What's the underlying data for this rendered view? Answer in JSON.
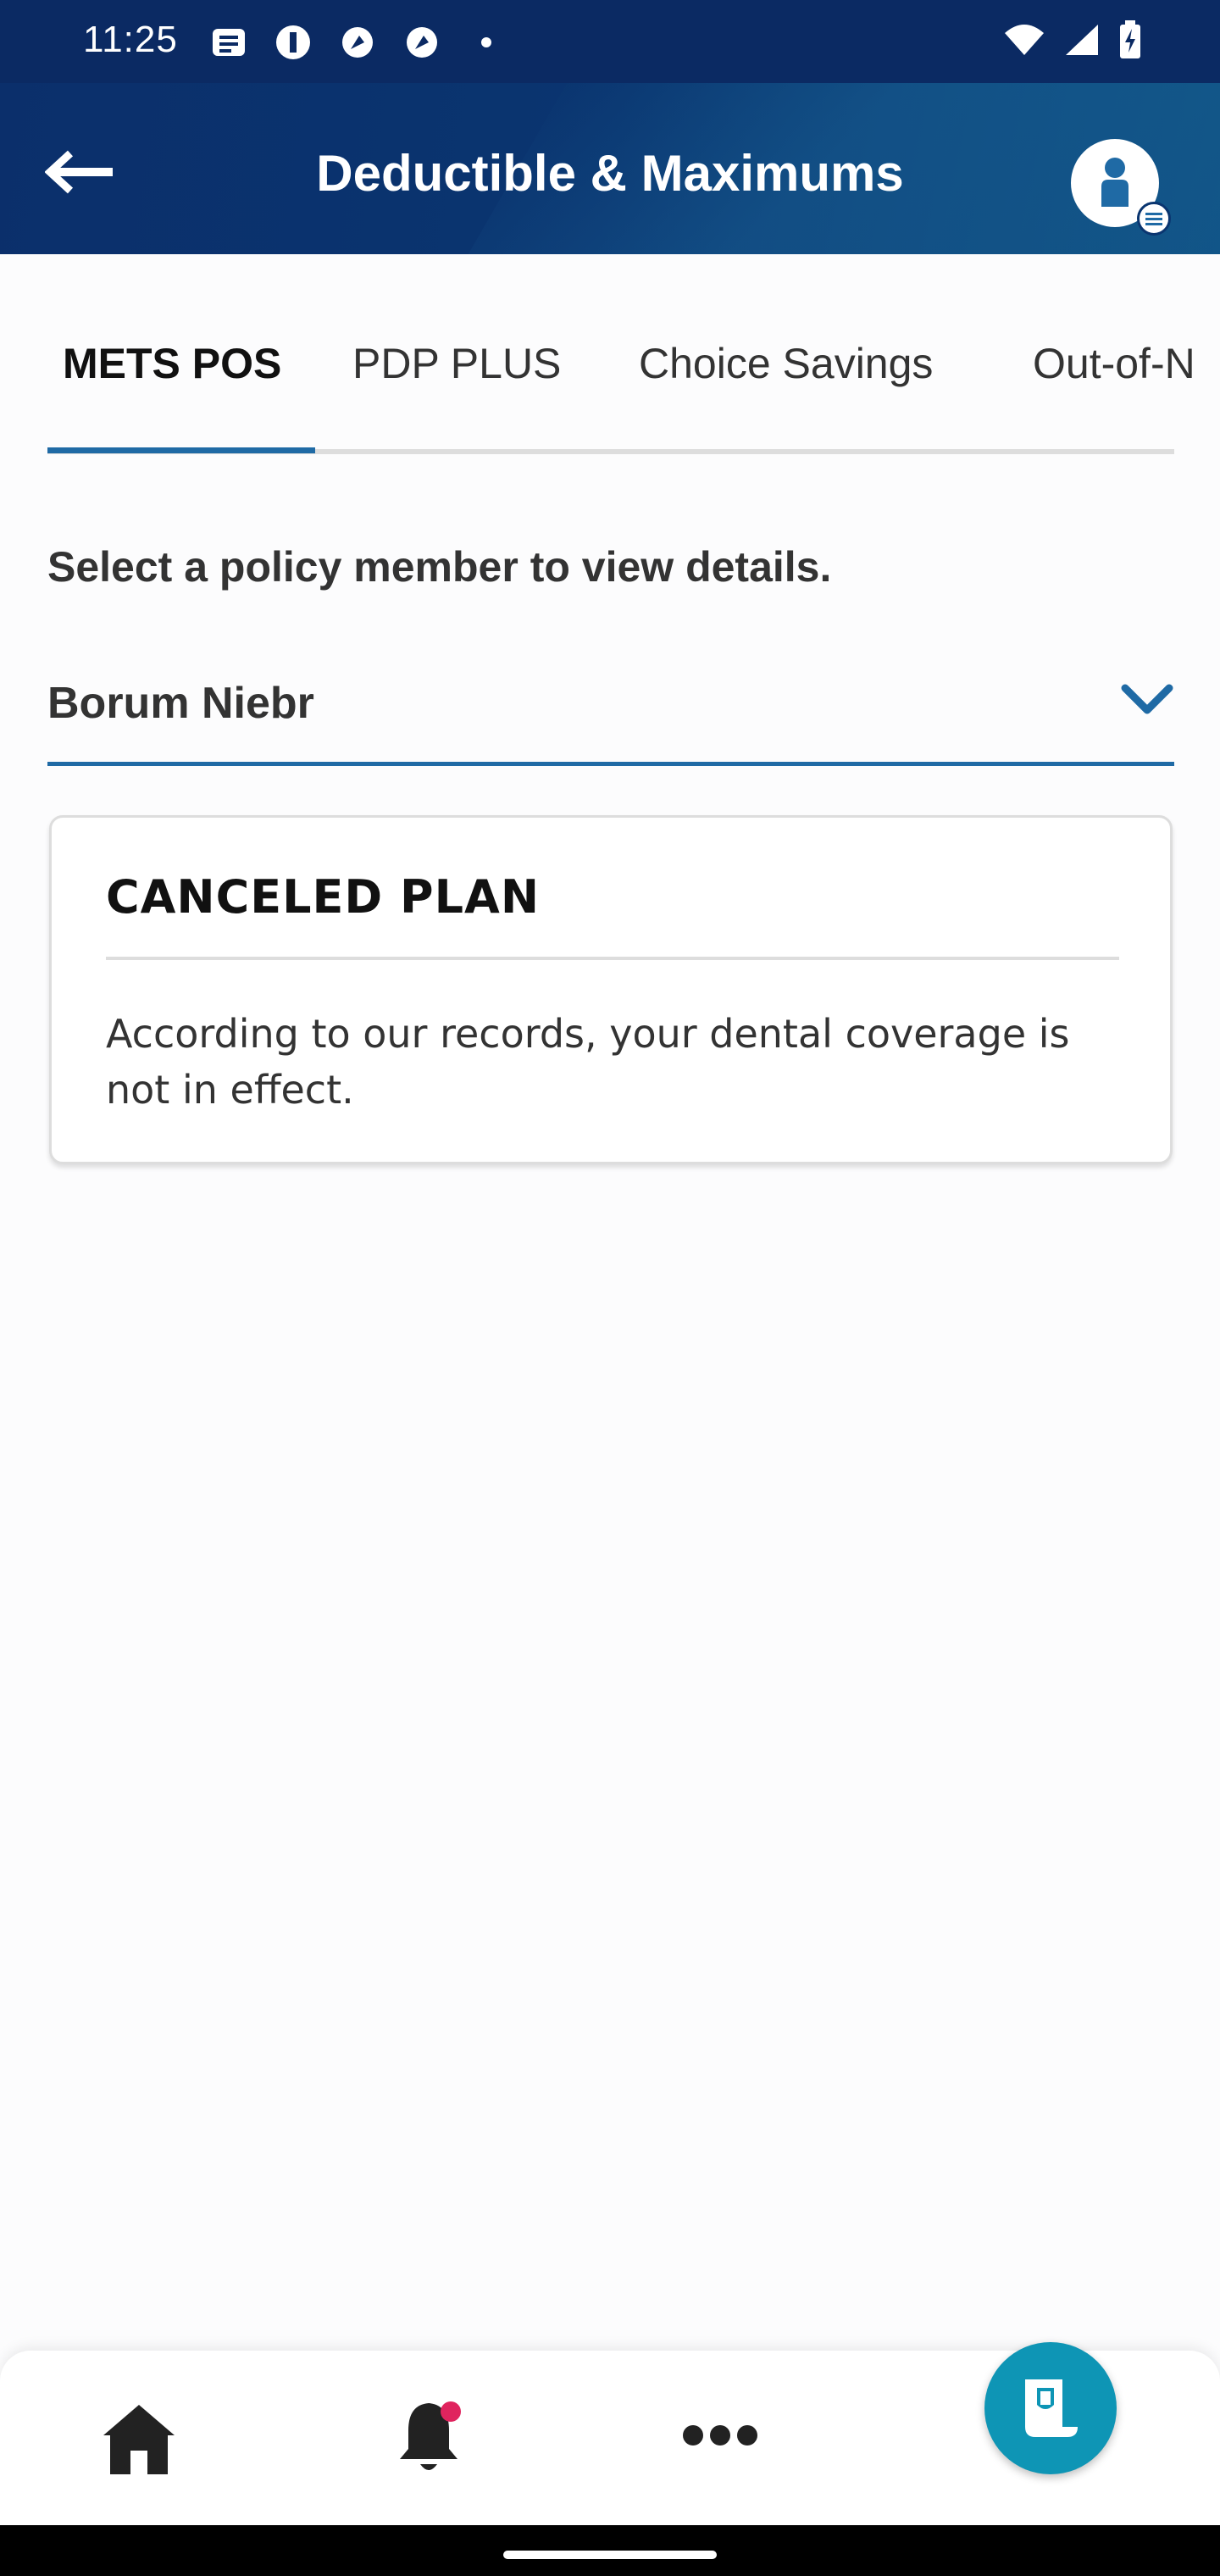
{
  "status_bar": {
    "time": "11:25",
    "notification_icons": [
      "message-icon",
      "app-icon",
      "app-icon",
      "app-icon",
      "dot-icon"
    ],
    "right_icons": [
      "wifi-icon",
      "signal-icon",
      "battery-icon"
    ]
  },
  "header": {
    "title": "Deductible & Maximums",
    "back_icon": "arrow-left-icon",
    "profile_icon": "person-icon"
  },
  "tabs": [
    {
      "label": "METS POS",
      "active": true
    },
    {
      "label": "PDP PLUS",
      "active": false
    },
    {
      "label": "Choice Savings",
      "active": false
    },
    {
      "label": "Out-of-N",
      "active": false
    }
  ],
  "member_select": {
    "prompt": "Select a policy member to view details.",
    "value": "Borum Niebr"
  },
  "card": {
    "title": "CANCELED PLAN",
    "body": "According to our records, your dental coverage is not in effect."
  },
  "bottom_nav": {
    "items": [
      "home-icon",
      "bell-icon",
      "more-icon",
      "id-card-icon"
    ],
    "bell_has_badge": true
  },
  "colors": {
    "header_bg": "#0b2f6b",
    "accent": "#1f6aa5",
    "fab": "#0e95b5",
    "badge": "#e0245e"
  }
}
